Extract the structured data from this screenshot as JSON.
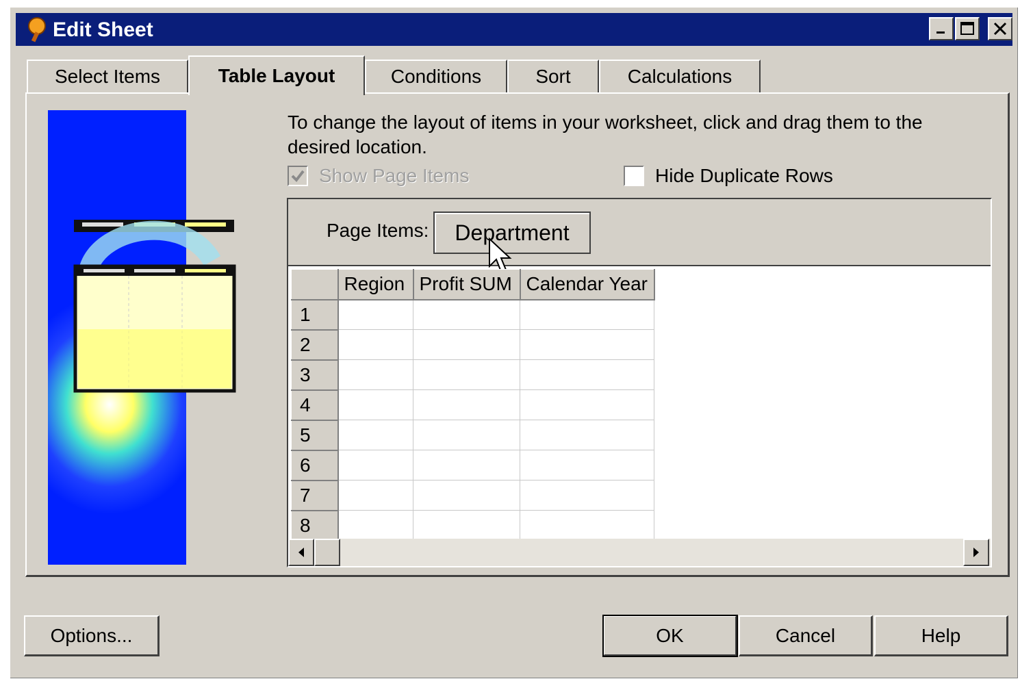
{
  "window": {
    "title": "Edit Sheet"
  },
  "tabs": [
    {
      "label": "Select Items"
    },
    {
      "label": "Table Layout"
    },
    {
      "label": "Conditions"
    },
    {
      "label": "Sort"
    },
    {
      "label": "Calculations"
    }
  ],
  "active_tab": "Table Layout",
  "instructions": "To change the layout of items in your worksheet, click and drag them to the desired location.",
  "options": {
    "show_page_items": {
      "label": "Show Page Items",
      "checked": true,
      "enabled": false
    },
    "hide_duplicate_rows": {
      "label": "Hide Duplicate Rows",
      "checked": false,
      "enabled": true
    }
  },
  "page_items": {
    "label": "Page Items:",
    "items": [
      "Department"
    ]
  },
  "grid": {
    "columns": [
      "Region",
      "Profit SUM",
      "Calendar Year"
    ],
    "row_numbers": [
      "1",
      "2",
      "3",
      "4",
      "5",
      "6",
      "7",
      "8"
    ]
  },
  "buttons": {
    "options": "Options...",
    "ok": "OK",
    "cancel": "Cancel",
    "help": "Help"
  }
}
